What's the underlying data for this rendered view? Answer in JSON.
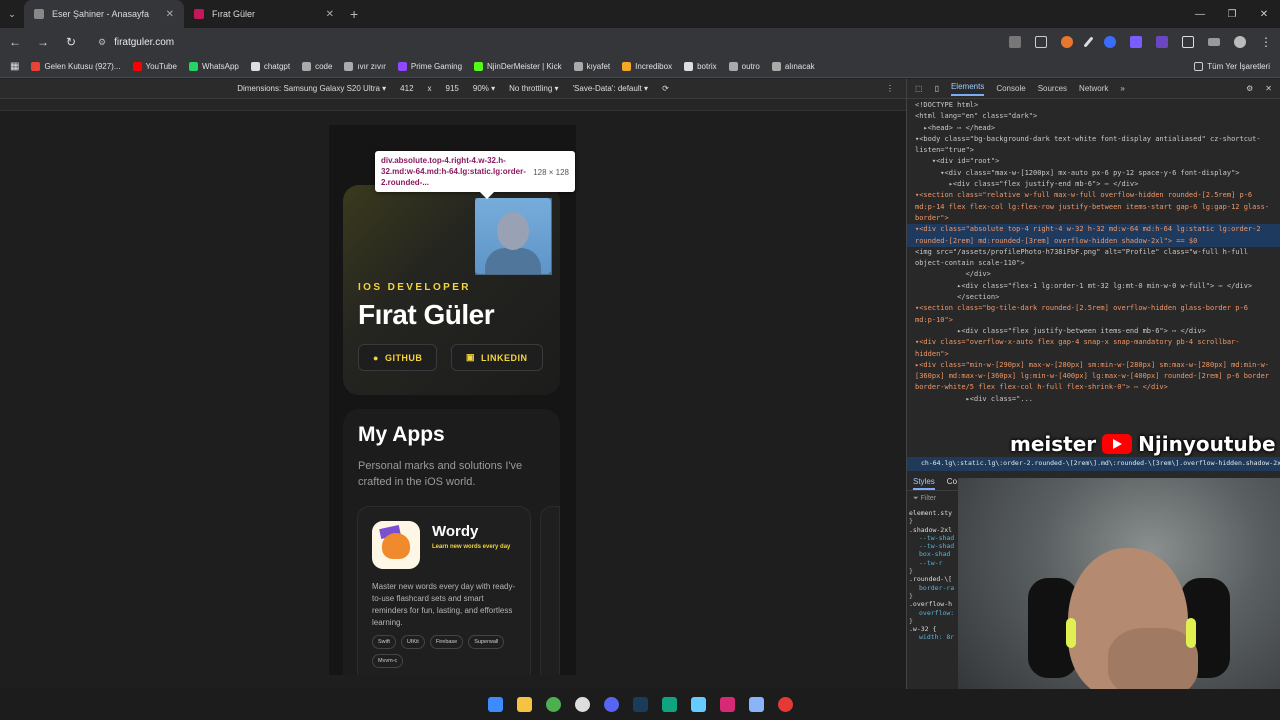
{
  "tabs": [
    {
      "title": "Eser Şahiner - Anasayfa",
      "active": true
    },
    {
      "title": "Fırat Güler",
      "active": false
    }
  ],
  "new_tab": "+",
  "window_controls": {
    "minimize": "—",
    "maximize": "❐",
    "close": "✕"
  },
  "toolbar": {
    "back": "←",
    "forward": "→",
    "reload": "↻",
    "url": "firatguler.com"
  },
  "bookmarks": [
    {
      "label": "Gelen Kutusu (927)...",
      "color": "#ea4335"
    },
    {
      "label": "YouTube",
      "color": "#ff0000"
    },
    {
      "label": "WhatsApp",
      "color": "#25d366"
    },
    {
      "label": "chatgpt",
      "color": "#dddddd"
    },
    {
      "label": "code",
      "color": "#aaaaaa"
    },
    {
      "label": "ıvır zıvır",
      "color": "#aaaaaa"
    },
    {
      "label": "Prime Gaming",
      "color": "#9146ff"
    },
    {
      "label": "NjinDerMeister | Kick",
      "color": "#53fc18"
    },
    {
      "label": "kıyafet",
      "color": "#aaaaaa"
    },
    {
      "label": "Incredibox",
      "color": "#f5a623"
    },
    {
      "label": "botrix",
      "color": "#dddddd"
    },
    {
      "label": "outro",
      "color": "#aaaaaa"
    },
    {
      "label": "alınacak",
      "color": "#aaaaaa"
    }
  ],
  "bookmarks_all": "Tüm Yer İşaretleri",
  "device_bar": {
    "dimensions": "Dimensions: Samsung Galaxy S20 Ultra ▾",
    "width": "412",
    "times": "x",
    "height": "915",
    "zoom": "90% ▾",
    "throttling": "No throttling ▾",
    "save_data": "'Save-Data': default ▾",
    "kebab": "⋮"
  },
  "site": {
    "role": "IOS DEVELOPER",
    "name": "Fırat Güler",
    "github": "GITHUB",
    "linkedin": "LINKEDIN",
    "apps_title": "My Apps",
    "apps_subtitle": "Personal marks and solutions I've crafted in the iOS world.",
    "app": {
      "name": "Wordy",
      "tagline": "Learn new words every day",
      "description": "Master new words every day with ready-to-use flashcard sets and smart reminders for fun, lasting, and effortless learning.",
      "chips": [
        "Swift",
        "UIKit",
        "Firebase",
        "Superwall",
        "Mvvm-c"
      ]
    }
  },
  "tooltip": {
    "class_text": "div.absolute.top-4.right-4.w-32.h-32.md:w-64.md:h-64.lg:static.lg:order-2.rounded-...",
    "dims": "128 × 128"
  },
  "devtools": {
    "tabs": [
      "Elements",
      "Console",
      "Sources",
      "Network",
      "»"
    ],
    "active_tab": "Elements",
    "dom_lines": [
      "<!DOCTYPE html>",
      "<html lang=\"en\" class=\"dark\">",
      "  ▸<head> ⋯ </head>",
      "  ▾<body class=\"bg-background-dark text-white font-display antialiased\" cz-shortcut-listen=\"true\">",
      "    ▾<div id=\"root\">",
      "      ▾<div class=\"max-w-[1200px] mx-auto px-6 py-12 space-y-6 font-display\">",
      "        ▸<div class=\"flex justify-end mb-6\"> ⋯ </div>",
      "        ▾<section class=\"relative w-full max-w-full overflow-hidden rounded-[2.5rem] p-6 md:p-14 flex flex-col lg:flex-row justify-between items-start gap-6 lg:gap-12 glass-border\">",
      "          ▾<div class=\"absolute top-4 right-4 w-32 h-32 md:w-64 md:h-64 lg:static lg:order-2 rounded-[2rem] md:rounded-[3rem] overflow-hidden shadow-2xl\"> == $0",
      "              <img src=\"/assets/profilePhoto-h738iFbF.png\" alt=\"Profile\" class=\"w-full h-full object-contain scale-110\">",
      "            </div>",
      "          ▸<div class=\"flex-1 lg:order-1 mt-32 lg:mt-0 min-w-0 w-full\"> ⋯ </div>",
      "          </section>",
      "        ▾<section class=\"bg-tile-dark rounded-[2.5rem] overflow-hidden glass-border p-6 md:p-10\">",
      "          ▸<div class=\"flex justify-between items-end mb-6\"> ⋯ </div>",
      "          ▾<div class=\"overflow-x-auto flex gap-4 snap-x snap-mandatory pb-4 scrollbar-hidden\">",
      "            ▸<div class=\"min-w-[290px] max-w-[280px] sm:min-w-[280px] sm:max-w-[280px] md:min-w-[360px] md:max-w-[360px] lg:min-w-[400px] lg:max-w-[400px] rounded-[2rem] p-6 border border-white/5 flex flex-col h-full flex-shrink-0\"> ⋯ </div>",
      "            ▸<div class=\"..."
    ],
    "crumb": "ch-64.lg\\:static.lg\\:order-2.rounded-\\[2rem\\].md\\:rounded-\\[3rem\\].overflow-hidden.shadow-2xl",
    "styles_tabs": [
      "Styles",
      "Co"
    ],
    "filter": "Filter",
    "css_lines": [
      "element.sty",
      "}",
      ".shadow-2xl",
      "  --tw-shad",
      "  --tw-shad",
      "  box-shad",
      "    --tw-r",
      "}",
      ".rounded-\\[",
      "  border-ra",
      "}",
      ".overflow-h",
      "  overflow:",
      "}",
      ".w-32 {",
      "  width: 8r"
    ]
  },
  "overlay": {
    "text1": "meister",
    "text2": "Njinyoutube"
  },
  "taskbar_icons": [
    {
      "name": "windows-start",
      "color": "#3d8bfd"
    },
    {
      "name": "file-explorer",
      "color": "#f5c242"
    },
    {
      "name": "chrome",
      "color": "#4caf50"
    },
    {
      "name": "obs",
      "color": "#dddddd"
    },
    {
      "name": "discord",
      "color": "#5865f2"
    },
    {
      "name": "steam",
      "color": "#1b3b5a"
    },
    {
      "name": "app-green",
      "color": "#10a37f"
    },
    {
      "name": "notepad",
      "color": "#66ccff"
    },
    {
      "name": "instagram",
      "color": "#d62976"
    },
    {
      "name": "settings",
      "color": "#8ab4f8"
    },
    {
      "name": "app-red",
      "color": "#e53935"
    }
  ]
}
